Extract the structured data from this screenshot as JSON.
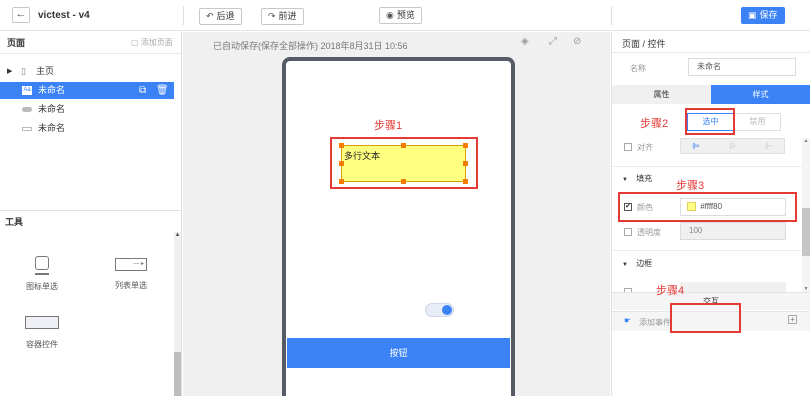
{
  "header": {
    "back_icon": "arrow-left-icon",
    "title": "victest - v4",
    "undo_label": "后退",
    "redo_label": "前进",
    "preview_label": "预览",
    "save_label": "保存"
  },
  "canvas_bar": {
    "autosave_text": "已自动保存(保存全部操作) 2018年8月31日 10:56",
    "icons": [
      "layers-icon",
      "expand-icon",
      "eye-off-icon"
    ]
  },
  "pages_panel": {
    "title": "页面",
    "add_page_label": "添加页面",
    "items": [
      {
        "label": "主页",
        "icon": "page-icon"
      },
      {
        "label": "未命名",
        "icon": "text-icon",
        "active": true
      },
      {
        "label": "未命名",
        "icon": "toggle-icon"
      },
      {
        "label": "未命名",
        "icon": "input-icon"
      }
    ]
  },
  "tools_panel": {
    "title": "工具",
    "tools": [
      {
        "label": "图标单选"
      },
      {
        "label": "列表单选"
      },
      {
        "label": "容器控件"
      }
    ]
  },
  "phone": {
    "textarea_text": "多行文本",
    "button_label": "按钮"
  },
  "annotations": {
    "step1": "步骤1",
    "step2": "步骤2",
    "step3": "步骤3",
    "step4": "步骤4",
    "color": "#e53935"
  },
  "props_panel": {
    "title": "页面 / 控件",
    "name_label": "名称",
    "name_value": "未命名",
    "tabs": [
      "属性",
      "样式"
    ],
    "active_tab": "样式",
    "selected_label": "选中",
    "disabled_label": "禁用",
    "align_label": "对齐",
    "fill_section": "填充",
    "color_label": "颜色",
    "color_value": "#ffff80",
    "opacity_label": "透明度",
    "opacity_value": "100",
    "border_section": "边框",
    "interaction_title": "交互",
    "add_event_label": "添加事件",
    "accent": "#3b82f6"
  }
}
